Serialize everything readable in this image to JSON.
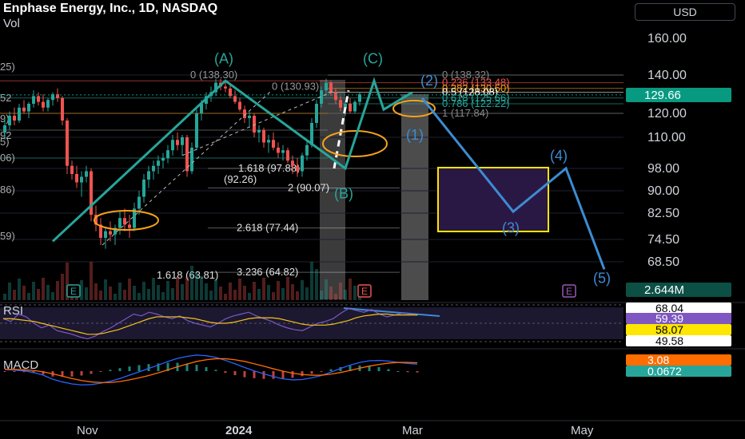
{
  "header": {
    "title": "Enphase Energy, Inc., 1D, NASDAQ",
    "volume_label": "Vol",
    "currency": "USD"
  },
  "colors": {
    "up": "#26a69a",
    "down": "#ef5350",
    "price_tag": "#089981",
    "wave": "#26a69a",
    "projection": "#3d8bd3",
    "orange": "#f7a21b",
    "yellow_box": "#ffe600",
    "purple_box": "#2a1844"
  },
  "chart_data": {
    "type": "candlestick",
    "x_ticks": [
      "Nov",
      "2024",
      "Mar",
      "May"
    ],
    "y_ticks": [
      "160.00",
      "140.00",
      "120.00",
      "110.00",
      "98.00",
      "90.00",
      "82.50",
      "74.50",
      "68.50"
    ],
    "last_price": "129.66",
    "volume_value": "2.644M",
    "left_edge_labels": [
      "25)",
      "52",
      "9)",
      "92",
      "5)",
      "06)",
      "86)",
      "59)"
    ],
    "candles": [
      {
        "o": 112,
        "h": 118,
        "l": 109,
        "c": 115
      },
      {
        "o": 115,
        "h": 121,
        "l": 113,
        "c": 119
      },
      {
        "o": 119,
        "h": 123,
        "l": 115,
        "c": 117
      },
      {
        "o": 117,
        "h": 125,
        "l": 116,
        "c": 123
      },
      {
        "o": 123,
        "h": 127,
        "l": 120,
        "c": 121
      },
      {
        "o": 121,
        "h": 126,
        "l": 118,
        "c": 125
      },
      {
        "o": 125,
        "h": 132,
        "l": 123,
        "c": 129
      },
      {
        "o": 129,
        "h": 131,
        "l": 124,
        "c": 126
      },
      {
        "o": 126,
        "h": 130,
        "l": 121,
        "c": 123
      },
      {
        "o": 123,
        "h": 128,
        "l": 121,
        "c": 127
      },
      {
        "o": 127,
        "h": 131,
        "l": 124,
        "c": 130
      },
      {
        "o": 130,
        "h": 133,
        "l": 126,
        "c": 128
      },
      {
        "o": 128,
        "h": 129,
        "l": 115,
        "c": 117
      },
      {
        "o": 117,
        "h": 118,
        "l": 96,
        "c": 99
      },
      {
        "o": 99,
        "h": 101,
        "l": 94,
        "c": 96
      },
      {
        "o": 96,
        "h": 99,
        "l": 91,
        "c": 93
      },
      {
        "o": 93,
        "h": 97,
        "l": 88,
        "c": 95
      },
      {
        "o": 95,
        "h": 99,
        "l": 93,
        "c": 97
      },
      {
        "o": 97,
        "h": 98,
        "l": 80,
        "c": 82
      },
      {
        "o": 82,
        "h": 85,
        "l": 77,
        "c": 79
      },
      {
        "o": 79,
        "h": 81,
        "l": 73,
        "c": 75
      },
      {
        "o": 75,
        "h": 78,
        "l": 72,
        "c": 77
      },
      {
        "o": 77,
        "h": 80,
        "l": 74,
        "c": 76
      },
      {
        "o": 76,
        "h": 79,
        "l": 73,
        "c": 78
      },
      {
        "o": 78,
        "h": 83,
        "l": 76,
        "c": 81
      },
      {
        "o": 81,
        "h": 84,
        "l": 77,
        "c": 79
      },
      {
        "o": 79,
        "h": 82,
        "l": 75,
        "c": 78
      },
      {
        "o": 78,
        "h": 86,
        "l": 77,
        "c": 84
      },
      {
        "o": 84,
        "h": 90,
        "l": 82,
        "c": 88
      },
      {
        "o": 88,
        "h": 96,
        "l": 86,
        "c": 94
      },
      {
        "o": 94,
        "h": 99,
        "l": 91,
        "c": 97
      },
      {
        "o": 97,
        "h": 101,
        "l": 94,
        "c": 99
      },
      {
        "o": 99,
        "h": 103,
        "l": 96,
        "c": 101
      },
      {
        "o": 101,
        "h": 104,
        "l": 98,
        "c": 102
      },
      {
        "o": 102,
        "h": 107,
        "l": 100,
        "c": 105
      },
      {
        "o": 105,
        "h": 111,
        "l": 103,
        "c": 109
      },
      {
        "o": 109,
        "h": 112,
        "l": 105,
        "c": 107
      },
      {
        "o": 107,
        "h": 111,
        "l": 103,
        "c": 110
      },
      {
        "o": 110,
        "h": 111,
        "l": 95,
        "c": 97
      },
      {
        "o": 97,
        "h": 108,
        "l": 96,
        "c": 106
      },
      {
        "o": 106,
        "h": 122,
        "l": 105,
        "c": 120
      },
      {
        "o": 120,
        "h": 127,
        "l": 117,
        "c": 125
      },
      {
        "o": 125,
        "h": 131,
        "l": 122,
        "c": 129
      },
      {
        "o": 129,
        "h": 134,
        "l": 126,
        "c": 131
      },
      {
        "o": 131,
        "h": 138,
        "l": 129,
        "c": 136
      },
      {
        "o": 136,
        "h": 138,
        "l": 132,
        "c": 134
      },
      {
        "o": 134,
        "h": 137,
        "l": 131,
        "c": 133
      },
      {
        "o": 133,
        "h": 135,
        "l": 128,
        "c": 129
      },
      {
        "o": 129,
        "h": 132,
        "l": 125,
        "c": 126
      },
      {
        "o": 126,
        "h": 128,
        "l": 121,
        "c": 122
      },
      {
        "o": 122,
        "h": 124,
        "l": 116,
        "c": 118
      },
      {
        "o": 118,
        "h": 121,
        "l": 114,
        "c": 119
      },
      {
        "o": 119,
        "h": 120,
        "l": 110,
        "c": 112
      },
      {
        "o": 112,
        "h": 115,
        "l": 108,
        "c": 113
      },
      {
        "o": 113,
        "h": 114,
        "l": 106,
        "c": 108
      },
      {
        "o": 108,
        "h": 111,
        "l": 104,
        "c": 109
      },
      {
        "o": 109,
        "h": 112,
        "l": 105,
        "c": 106
      },
      {
        "o": 106,
        "h": 108,
        "l": 102,
        "c": 104
      },
      {
        "o": 104,
        "h": 107,
        "l": 101,
        "c": 105
      },
      {
        "o": 105,
        "h": 106,
        "l": 100,
        "c": 101
      },
      {
        "o": 101,
        "h": 103,
        "l": 96,
        "c": 99
      },
      {
        "o": 99,
        "h": 102,
        "l": 95,
        "c": 97
      },
      {
        "o": 97,
        "h": 104,
        "l": 95,
        "c": 103
      },
      {
        "o": 103,
        "h": 109,
        "l": 101,
        "c": 107
      },
      {
        "o": 107,
        "h": 118,
        "l": 106,
        "c": 116
      },
      {
        "o": 116,
        "h": 127,
        "l": 114,
        "c": 125
      },
      {
        "o": 125,
        "h": 134,
        "l": 123,
        "c": 132
      },
      {
        "o": 132,
        "h": 138,
        "l": 129,
        "c": 136
      },
      {
        "o": 136,
        "h": 137,
        "l": 129,
        "c": 131
      },
      {
        "o": 131,
        "h": 133,
        "l": 125,
        "c": 127
      },
      {
        "o": 127,
        "h": 129,
        "l": 121,
        "c": 123
      },
      {
        "o": 123,
        "h": 126,
        "l": 119,
        "c": 125
      },
      {
        "o": 125,
        "h": 128,
        "l": 120,
        "c": 121
      },
      {
        "o": 121,
        "h": 127,
        "l": 120,
        "c": 126
      },
      {
        "o": 126,
        "h": 131,
        "l": 124,
        "c": 130
      }
    ],
    "wave_path": [
      {
        "i": 10,
        "v": 74
      },
      {
        "i": 46,
        "v": 137
      },
      {
        "i": 71,
        "v": 98
      },
      {
        "i": 77,
        "v": 137
      },
      {
        "i": 79,
        "v": 122
      },
      {
        "i": 85,
        "v": 131
      }
    ],
    "wave_labels": [
      {
        "text": "(A)",
        "i": 46,
        "v": 149
      },
      {
        "text": "(B)",
        "i": 71,
        "v": 89
      },
      {
        "text": "(C)",
        "i": 77,
        "v": 149
      },
      {
        "text": "(1)",
        "i": 86,
        "v": 111
      },
      {
        "text": "(2)",
        "i": 89,
        "v": 137
      }
    ],
    "projection_path": [
      {
        "i": 87,
        "v": 128
      },
      {
        "i": 106,
        "v": 83
      },
      {
        "i": 117,
        "v": 98
      },
      {
        "i": 125,
        "v": 66
      }
    ],
    "projection_labels": [
      {
        "text": "(3)",
        "i": 106,
        "v": 78
      },
      {
        "text": "(4)",
        "i": 116,
        "v": 103
      },
      {
        "text": "(5)",
        "i": 125,
        "v": 63
      }
    ],
    "fib_upper": [
      {
        "label": "0 (138.32)",
        "v": 140,
        "color": "#888888"
      },
      {
        "label": "0.236 (133.48)",
        "v": 136,
        "color": "#ef5350"
      },
      {
        "label": "0.382 (130.50)",
        "v": 133,
        "color": "#f7a21b"
      },
      {
        "label": "0.5 (128.08)",
        "v": 131,
        "color": "#ffffff"
      },
      {
        "label": "0.618 (125.66)",
        "v": 128,
        "color": "#26a69a"
      },
      {
        "label": "0.786 (122.22)",
        "v": 125,
        "color": "#26a69a"
      },
      {
        "label": "1 (117.84)",
        "v": 120,
        "color": "#888888"
      }
    ],
    "fib_left": [
      {
        "label": "0 (138.30)",
        "v": 140
      },
      {
        "label": "0 (130.93)",
        "v": 134
      }
    ],
    "fib_lower": [
      {
        "label": "1.618 (97.88)",
        "v": 98
      },
      {
        "label": "(92.26)",
        "v": 94
      },
      {
        "label": "2 (90.07)",
        "v": 91
      },
      {
        "label": "2.618 (77.44)",
        "v": 78
      },
      {
        "label": "3.236 (64.82)",
        "v": 65
      },
      {
        "label": "1.618 (63.81)",
        "v": 64
      }
    ],
    "earnings_markers": [
      "E",
      "E",
      "E"
    ],
    "rsi": {
      "label": "RSI",
      "values": [
        55,
        52,
        60,
        57,
        50,
        45,
        48,
        42,
        40,
        38,
        35,
        33,
        36,
        41,
        45,
        50,
        55,
        60,
        58,
        62,
        60,
        57,
        55,
        58,
        53,
        50,
        48,
        46,
        50,
        55,
        58,
        60,
        62,
        58,
        55,
        52,
        48,
        45,
        43,
        42,
        46,
        50,
        52,
        55,
        61,
        66,
        64,
        62,
        65,
        60,
        57,
        59,
        61,
        60,
        59
      ],
      "signal": [
        55,
        55,
        54,
        53,
        52,
        50,
        48,
        46,
        44,
        42,
        40,
        38,
        38,
        39,
        41,
        43,
        46,
        49,
        52,
        55,
        57,
        57,
        57,
        57,
        56,
        55,
        53,
        51,
        50,
        50,
        51,
        53,
        55,
        56,
        56,
        56,
        55,
        53,
        51,
        49,
        48,
        48,
        48,
        49,
        51,
        53,
        56,
        58,
        59,
        60,
        60,
        59,
        59,
        59,
        59
      ],
      "tags": [
        "68.04",
        "59.39",
        "58.07",
        "49.58"
      ]
    },
    "macd": {
      "label": "MACD",
      "macd_line": [
        0.5,
        0.3,
        0.1,
        -0.4,
        -1.2,
        -2.4,
        -3.2,
        -3.8,
        -4.1,
        -4.0,
        -3.6,
        -3.0,
        -2.2,
        -1.2,
        -0.2,
        0.8,
        1.8,
        2.9,
        3.8,
        4.4,
        4.8,
        4.6,
        4.1,
        3.2,
        2.2,
        1.1,
        0.1,
        -0.8,
        -1.6,
        -2.3,
        -2.6,
        -2.5,
        -2.0,
        -1.3,
        -0.3,
        0.8,
        1.8,
        2.6,
        3.1,
        3.2,
        3.0,
        2.6,
        2.3,
        2.1
      ],
      "signal_line": [
        0.6,
        0.5,
        0.4,
        0.2,
        -0.2,
        -0.8,
        -1.5,
        -2.2,
        -2.8,
        -3.2,
        -3.4,
        -3.4,
        -3.1,
        -2.6,
        -2.0,
        -1.3,
        -0.5,
        0.4,
        1.3,
        2.1,
        2.9,
        3.4,
        3.7,
        3.7,
        3.4,
        2.9,
        2.2,
        1.5,
        0.7,
        0.0,
        -0.6,
        -1.0,
        -1.2,
        -1.2,
        -0.9,
        -0.4,
        0.2,
        0.9,
        1.5,
        2.0,
        2.4,
        2.6,
        2.6,
        2.5
      ],
      "tags": [
        "3.08",
        "0.0672"
      ]
    }
  }
}
